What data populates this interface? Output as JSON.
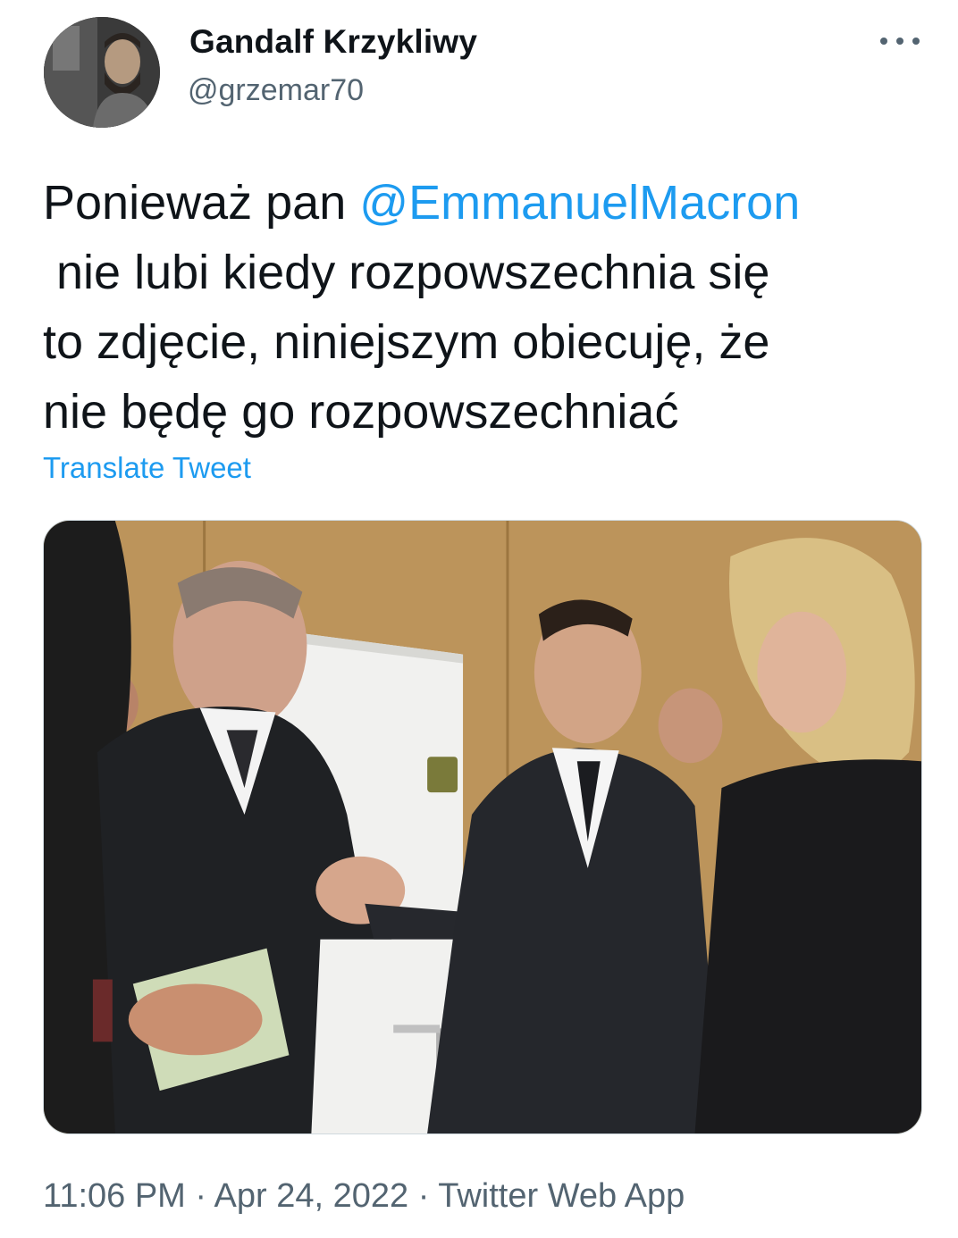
{
  "user": {
    "display_name": "Gandalf Krzykliwy",
    "handle": "@grzemar70"
  },
  "menu": {
    "icon": "more-horizontal-icon"
  },
  "tweet": {
    "text_before": "Ponieważ pan ",
    "mention": "@EmmanuelMacron",
    "text_after": "\n nie lubi kiedy rozpowszechnia się\nto zdjęcie, niniejszym obiecuję, że\nnie będę go rozpowszechniać",
    "translate_label": "Translate Tweet"
  },
  "meta": {
    "time": "11:06 PM",
    "separator": " · ",
    "date": "Apr 24, 2022",
    "source": "Twitter Web App"
  },
  "colors": {
    "link": "#1d9bf0",
    "secondary_text": "#536471",
    "primary_text": "#0f1419"
  }
}
